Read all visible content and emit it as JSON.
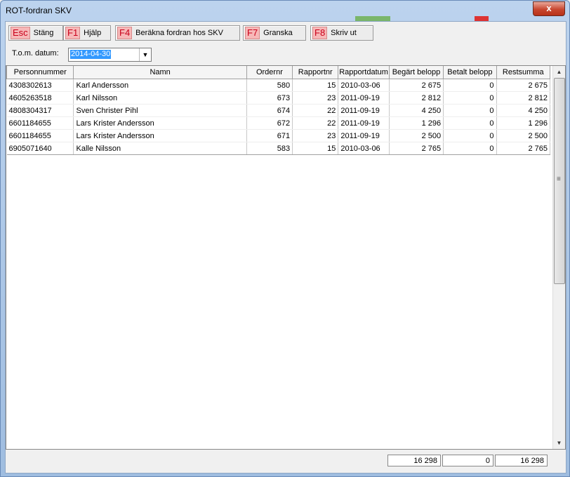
{
  "window": {
    "title": "ROT-fordran SKV",
    "close_glyph": "x"
  },
  "toolbar": {
    "buttons": [
      {
        "key": "Esc",
        "label": "Stäng"
      },
      {
        "key": "F1",
        "label": "Hjälp"
      },
      {
        "key": "F4",
        "label": "Beräkna fordran hos SKV"
      },
      {
        "key": "F7",
        "label": "Granska"
      },
      {
        "key": "F8",
        "label": "Skriv ut"
      }
    ]
  },
  "date": {
    "label": "T.o.m. datum:",
    "value": "2014-04-30"
  },
  "table": {
    "columns": [
      "Personnummer",
      "Namn",
      "Ordernr",
      "Rapportnr",
      "Rapportdatum",
      "Begärt belopp",
      "Betalt belopp",
      "Restsumma"
    ],
    "rows": [
      [
        "4308302613",
        "Karl Andersson",
        "580",
        "15",
        "2010-03-06",
        "2 675",
        "0",
        "2 675"
      ],
      [
        "4605263518",
        "Karl Nilsson",
        "673",
        "23",
        "2011-09-19",
        "2 812",
        "0",
        "2 812"
      ],
      [
        "4808304317",
        "Sven Christer Pihl",
        "674",
        "22",
        "2011-09-19",
        "4 250",
        "0",
        "4 250"
      ],
      [
        "6601184655",
        "Lars Krister Andersson",
        "672",
        "22",
        "2011-09-19",
        "1 296",
        "0",
        "1 296"
      ],
      [
        "6601184655",
        "Lars Krister Andersson",
        "671",
        "23",
        "2011-09-19",
        "2 500",
        "0",
        "2 500"
      ],
      [
        "6905071640",
        "Kalle Nilsson",
        "583",
        "15",
        "2010-03-06",
        "2 765",
        "0",
        "2 765"
      ]
    ]
  },
  "totals": {
    "begart": "16 298",
    "betalt": "0",
    "rest": "16 298"
  },
  "colors": {
    "key_text": "#c8001a",
    "key_bg": "#f7b8b8",
    "selection": "#3399ff",
    "close_button": "#c8472f"
  }
}
